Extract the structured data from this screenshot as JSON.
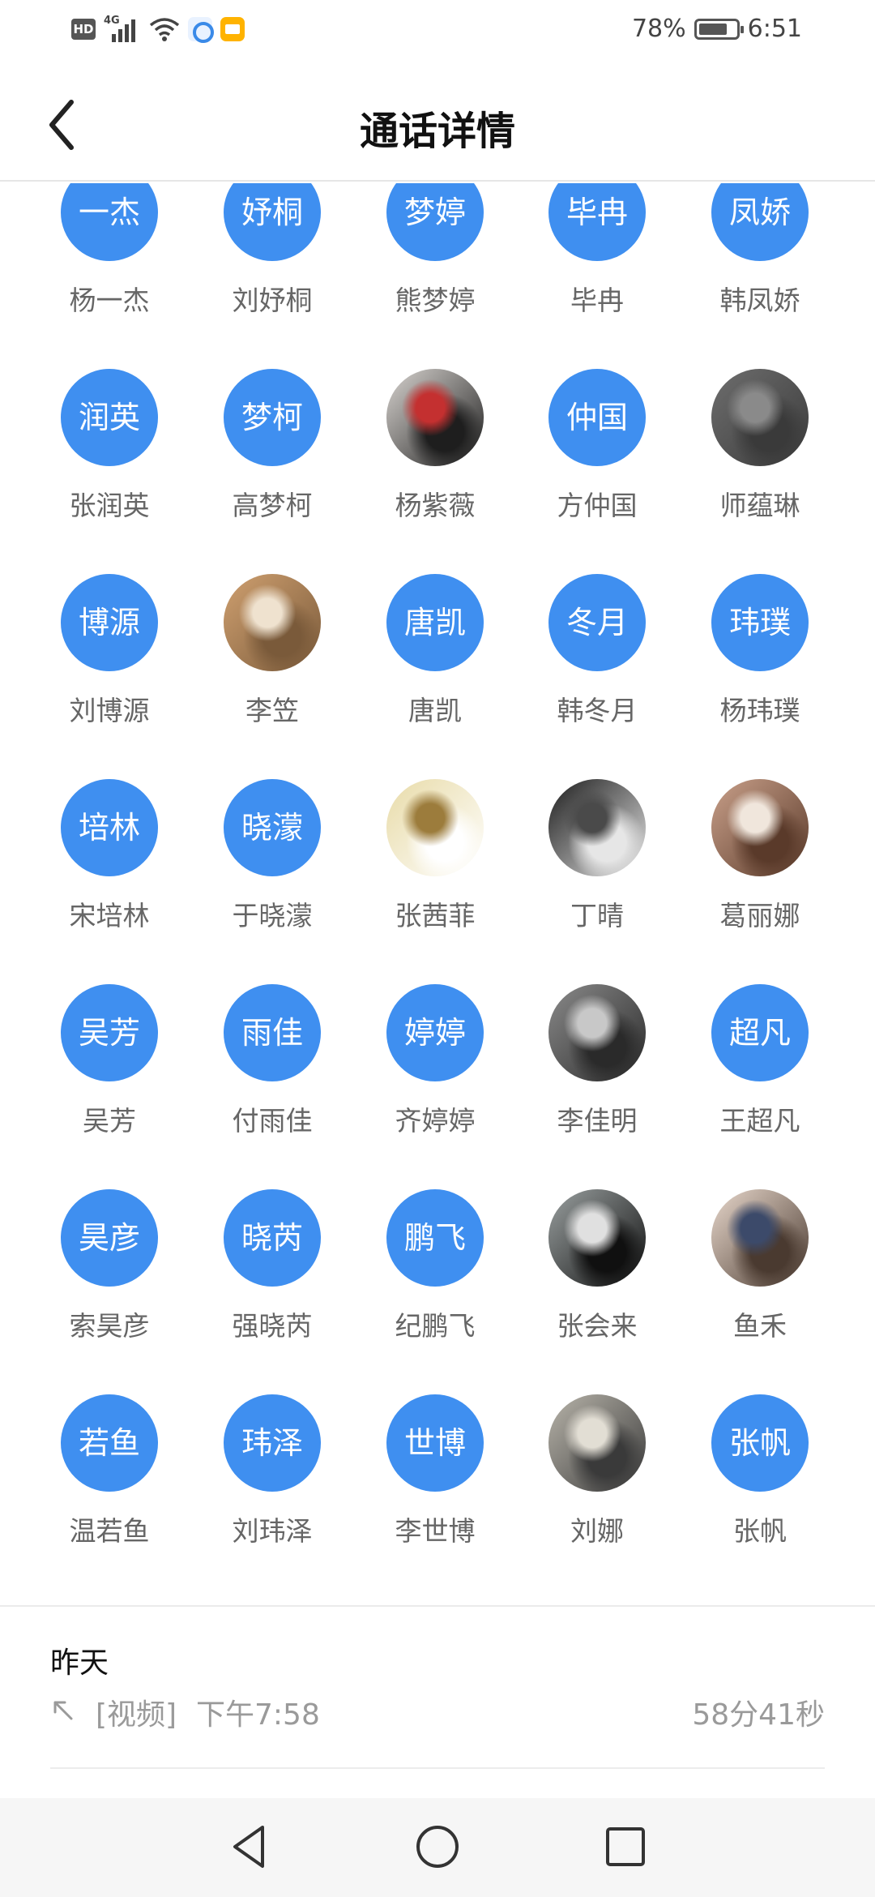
{
  "status_bar": {
    "network_badge": "HD",
    "network_type": "4G",
    "battery_text": "78%",
    "battery_level": 0.78,
    "time": "6:51"
  },
  "header": {
    "title": "通话详情"
  },
  "participants": [
    {
      "name": "杨一杰",
      "avatar_text": "一杰",
      "avatar_kind": "text"
    },
    {
      "name": "刘妤桐",
      "avatar_text": "妤桐",
      "avatar_kind": "text"
    },
    {
      "name": "熊梦婷",
      "avatar_text": "梦婷",
      "avatar_kind": "text"
    },
    {
      "name": "毕冉",
      "avatar_text": "毕冉",
      "avatar_kind": "text"
    },
    {
      "name": "韩凤娇",
      "avatar_text": "凤娇",
      "avatar_kind": "text"
    },
    {
      "name": "张润英",
      "avatar_text": "润英",
      "avatar_kind": "text"
    },
    {
      "name": "高梦柯",
      "avatar_text": "梦柯",
      "avatar_kind": "text"
    },
    {
      "name": "杨紫薇",
      "avatar_text": "",
      "avatar_kind": "photo",
      "photo_colors": [
        "#d8d4d0",
        "#1e1e1e",
        "#c43030"
      ]
    },
    {
      "name": "方仲国",
      "avatar_text": "仲国",
      "avatar_kind": "text"
    },
    {
      "name": "师蕴琳",
      "avatar_text": "",
      "avatar_kind": "photo",
      "photo_colors": [
        "#6e6e6e",
        "#3a3a3a",
        "#8a8a8a"
      ]
    },
    {
      "name": "刘博源",
      "avatar_text": "博源",
      "avatar_kind": "text"
    },
    {
      "name": "李笠",
      "avatar_text": "",
      "avatar_kind": "photo",
      "photo_colors": [
        "#cfa070",
        "#7a5a3a",
        "#efe2cf"
      ]
    },
    {
      "name": "唐凯",
      "avatar_text": "唐凯",
      "avatar_kind": "text"
    },
    {
      "name": "韩冬月",
      "avatar_text": "冬月",
      "avatar_kind": "text"
    },
    {
      "name": "杨玮璞",
      "avatar_text": "玮璞",
      "avatar_kind": "text"
    },
    {
      "name": "宋培林",
      "avatar_text": "培林",
      "avatar_kind": "text"
    },
    {
      "name": "于晓濛",
      "avatar_text": "晓濛",
      "avatar_kind": "text"
    },
    {
      "name": "张茜菲",
      "avatar_text": "",
      "avatar_kind": "photo",
      "photo_colors": [
        "#e8dba8",
        "#ffffff",
        "#9c7c3c"
      ]
    },
    {
      "name": "丁晴",
      "avatar_text": "",
      "avatar_kind": "photo",
      "photo_colors": [
        "#1c1c1c",
        "#e6e6e6",
        "#4a4a4a"
      ]
    },
    {
      "name": "葛丽娜",
      "avatar_text": "",
      "avatar_kind": "photo",
      "photo_colors": [
        "#c9a08a",
        "#5a3a2a",
        "#f0e6dc"
      ]
    },
    {
      "name": "吴芳",
      "avatar_text": "吴芳",
      "avatar_kind": "text"
    },
    {
      "name": "付雨佳",
      "avatar_text": "雨佳",
      "avatar_kind": "text"
    },
    {
      "name": "齐婷婷",
      "avatar_text": "婷婷",
      "avatar_kind": "text"
    },
    {
      "name": "李佳明",
      "avatar_text": "",
      "avatar_kind": "photo",
      "photo_colors": [
        "#8a8a8a",
        "#2a2a2a",
        "#c8c8c8"
      ]
    },
    {
      "name": "王超凡",
      "avatar_text": "超凡",
      "avatar_kind": "text"
    },
    {
      "name": "索昊彦",
      "avatar_text": "昊彦",
      "avatar_kind": "text"
    },
    {
      "name": "强晓芮",
      "avatar_text": "晓芮",
      "avatar_kind": "text"
    },
    {
      "name": "纪鹏飞",
      "avatar_text": "鹏飞",
      "avatar_kind": "text"
    },
    {
      "name": "张会来",
      "avatar_text": "",
      "avatar_kind": "photo",
      "photo_colors": [
        "#9aa0a0",
        "#101010",
        "#e0e0e0"
      ]
    },
    {
      "name": "鱼禾",
      "avatar_text": "",
      "avatar_kind": "photo",
      "photo_colors": [
        "#e8d8cc",
        "#4a3a30",
        "#3c4a6a"
      ]
    },
    {
      "name": "温若鱼",
      "avatar_text": "若鱼",
      "avatar_kind": "text"
    },
    {
      "name": "刘玮泽",
      "avatar_text": "玮泽",
      "avatar_kind": "text"
    },
    {
      "name": "李世博",
      "avatar_text": "世博",
      "avatar_kind": "text"
    },
    {
      "name": "刘娜",
      "avatar_text": "",
      "avatar_kind": "photo",
      "photo_colors": [
        "#b8b4aa",
        "#3a3a3a",
        "#e2ded4"
      ]
    },
    {
      "name": "张帆",
      "avatar_text": "张帆",
      "avatar_kind": "text"
    }
  ],
  "call_record": {
    "date": "昨天",
    "direction_icon": "outgoing-arrow-icon",
    "type": "[视频]",
    "time": "下午7:58",
    "duration": "58分41秒"
  },
  "colors": {
    "avatar_blue": "#3f8ff0",
    "name_gray": "#666666",
    "meta_gray": "#9a9a9a"
  }
}
